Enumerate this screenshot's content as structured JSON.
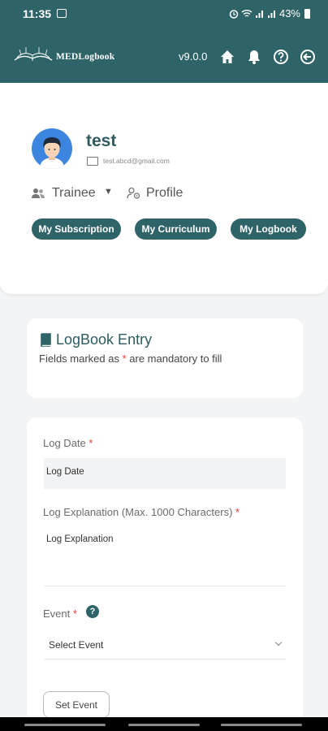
{
  "status_bar": {
    "time": "11:35",
    "battery": "43%",
    "icons": [
      "photo-icon",
      "alarm-icon",
      "wifi-icon",
      "signal-icon",
      "signal-icon",
      "battery-icon"
    ]
  },
  "app_bar": {
    "logo_text": "MEDLogbook",
    "version": "v9.0.0",
    "icons": [
      "home-icon",
      "bell-icon",
      "help-icon",
      "logout-icon"
    ]
  },
  "profile": {
    "name": "test",
    "email": "test.abcd@gmail.com",
    "role": "Trainee",
    "profile_link": "Profile",
    "buttons": {
      "subscription": "My Subscription",
      "curriculum": "My Curriculum",
      "logbook": "My Logbook"
    }
  },
  "entry": {
    "title": "LogBook Entry",
    "sub_prefix": "Fields marked as ",
    "required_mark": "*",
    "sub_suffix": " are mandatory to fill"
  },
  "form": {
    "log_date": {
      "label": "Log Date",
      "placeholder": "Log Date"
    },
    "log_explanation": {
      "label": "Log Explanation (Max. 1000 Characters)",
      "placeholder": "Log Explanation"
    },
    "event": {
      "label": "Event",
      "help": "?",
      "selected": "Select Event"
    },
    "set_event_label": "Set Event"
  },
  "colors": {
    "primary": "#2e6468",
    "required": "#e53935",
    "avatar_bg": "#3c86e0"
  }
}
